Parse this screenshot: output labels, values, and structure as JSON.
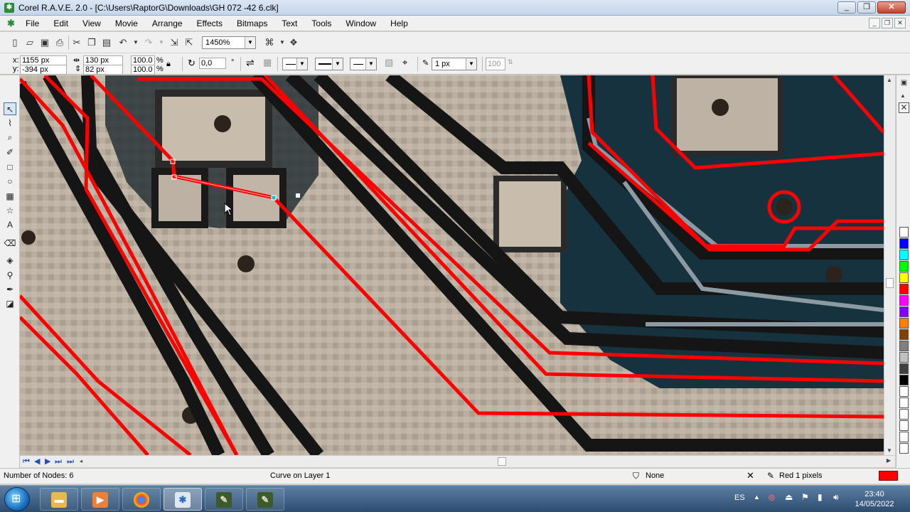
{
  "window": {
    "title": "Corel R.A.V.E. 2.0 - [C:\\Users\\RaptorG\\Downloads\\GH 072 -42 6.clk]",
    "minimize": "_",
    "restore": "❐",
    "close": "✕"
  },
  "menu": [
    "File",
    "Edit",
    "View",
    "Movie",
    "Arrange",
    "Effects",
    "Bitmaps",
    "Text",
    "Tools",
    "Window",
    "Help"
  ],
  "mdi": {
    "minimize": "_",
    "restore": "❐",
    "close": "✕"
  },
  "toolbar": {
    "zoom": "1450%"
  },
  "property_bar": {
    "x_label": "x:",
    "x_value": "1155 px",
    "y_label": "y:",
    "y_value": "-394 px",
    "width_value": "130 px",
    "height_value": "82 px",
    "scale_x": "100.0",
    "scale_y": "100.0",
    "percent": "%",
    "rotation": "0,0",
    "degree": "°",
    "outline_width": "1 px",
    "opacity": "100"
  },
  "status": {
    "nodes": "Number of Nodes: 6",
    "object": "Curve on Layer 1",
    "fill": "None",
    "outline": "Red  1 pixels"
  },
  "colors": {
    "trace": "#ff0000",
    "board": "#b8ada0",
    "dark_board": "#16303f",
    "selected_outline": "#ff0000"
  },
  "palette": [
    "#ffffff",
    "#0000ff",
    "#00ffff",
    "#00ff00",
    "#ffff00",
    "#ff0000",
    "#ff00ff",
    "#8000ff",
    "#ff8000",
    "#804000",
    "#808080",
    "#c0c0c0",
    "#404040",
    "#000000",
    "#ffffff",
    "#ffffff",
    "#ffffff",
    "#ffffff",
    "#ffffff",
    "#ffffff"
  ],
  "taskbar": {
    "language": "ES",
    "time": "23:40",
    "date": "14/05/2022"
  }
}
